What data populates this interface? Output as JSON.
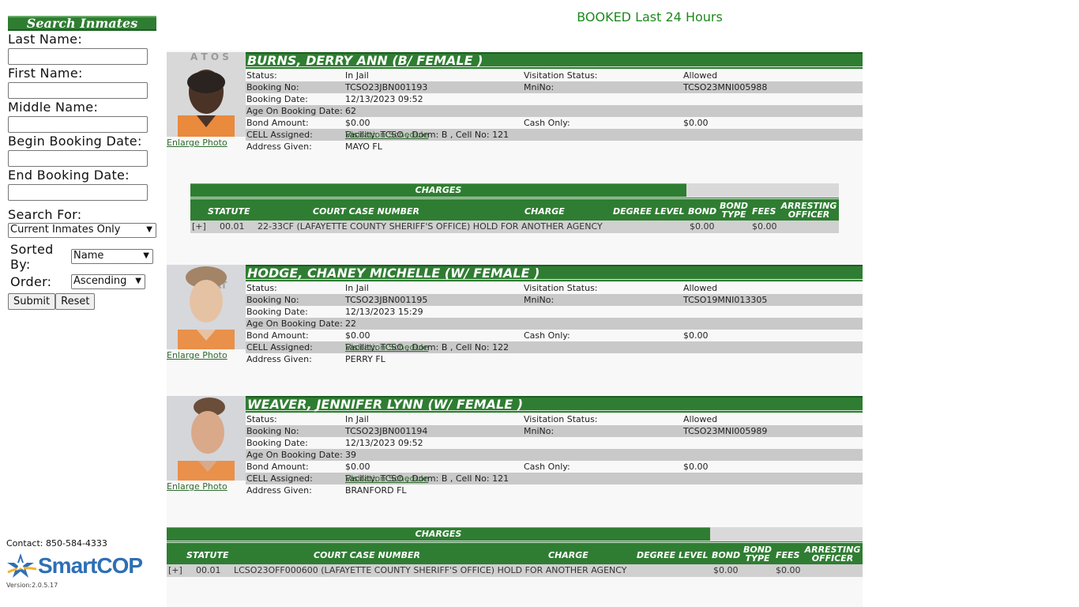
{
  "sidebar": {
    "title": "Search Inmates",
    "last_name_label": "Last Name:",
    "first_name_label": "First Name:",
    "middle_name_label": "Middle Name:",
    "begin_date_label": "Begin Booking Date:",
    "end_date_label": "End Booking Date:",
    "search_for_label": "Search For:",
    "search_for_value": "Current Inmates Only",
    "sorted_by_label": "Sorted By:",
    "sorted_by_value": "Name",
    "order_label": "Order:",
    "order_value": "Ascending",
    "submit_label": "Submit",
    "reset_label": "Reset"
  },
  "footer": {
    "contact": "Contact: 850-584-4333",
    "logo_smart": "Smart",
    "logo_cop": "COP",
    "version": "Version:2.0.5.17"
  },
  "page_title": "BOOKED Last 24 Hours",
  "labels": {
    "status": "Status:",
    "visitation_status": "Visitation Status:",
    "booking_no": "Booking No:",
    "mnino": "MniNo:",
    "booking_date": "Booking Date:",
    "age": "Age On Booking Date:",
    "bond_amount": "Bond Amount:",
    "cash_only": "Cash Only:",
    "cell": "CELL Assigned:",
    "address": "Address Given:",
    "enlarge_photo": "Enlarge Photo",
    "visitation_schedule": "Visitation Schedule"
  },
  "charges_header": {
    "title": "CHARGES",
    "statute": "STATUTE",
    "court_case": "COURT CASE NUMBER",
    "charge": "CHARGE",
    "degree_level": "DEGREE LEVEL",
    "bond": "BOND",
    "bond_type": "BOND TYPE",
    "fees": "FEES",
    "arresting_officer": "ARRESTING OFFICER"
  },
  "inmates": [
    {
      "name": "BURNS, DERRY ANN   (B/ FEMALE )",
      "status": "In Jail",
      "visitation_status": "Allowed",
      "booking_no": "TCSO23JBN001193",
      "mnino": "TCSO23MNI005988",
      "booking_date": "12/13/2023 09:52",
      "age": "62",
      "bond_amount": "$0.00",
      "cash_only": "$0.00",
      "cell": "Facility: TCSO , Dorm: B , Cell No: 121",
      "address": "MAYO FL",
      "charge": {
        "expand": "[+]",
        "statute": "00.01",
        "text": "22-33CF (LAFAYETTE COUNTY SHERIFF'S OFFICE) HOLD FOR ANOTHER AGENCY",
        "bond": "$0.00",
        "fees": "$0.00"
      }
    },
    {
      "name": "HODGE, CHANEY MICHELLE   (W/ FEMALE )",
      "status": "In Jail",
      "visitation_status": "Allowed",
      "booking_no": "TCSO23JBN001195",
      "mnino": "TCSO19MNI013305",
      "booking_date": "12/13/2023 15:29",
      "age": "22",
      "bond_amount": "$0.00",
      "cash_only": "$0.00",
      "cell": "Facility: TCSO , Dorm: B , Cell No: 122",
      "address": "PERRY FL"
    },
    {
      "name": "WEAVER, JENNIFER LYNN   (W/ FEMALE )",
      "status": "In Jail",
      "visitation_status": "Allowed",
      "booking_no": "TCSO23JBN001194",
      "mnino": "TCSO23MNI005989",
      "booking_date": "12/13/2023 09:52",
      "age": "39",
      "bond_amount": "$0.00",
      "cash_only": "$0.00",
      "cell": "Facility: TCSO , Dorm: B , Cell No: 121",
      "address": "BRANFORD FL",
      "charge": {
        "expand": "[+]",
        "statute": "00.01",
        "text": "LCSO23OFF000600 (LAFAYETTE COUNTY SHERIFF'S OFFICE) HOLD FOR ANOTHER AGENCY",
        "bond": "$0.00",
        "fees": "$0.00"
      }
    }
  ],
  "colors": {
    "header_green": "#2f7d32",
    "title_green": "#1e8a1e",
    "link_green": "#2f6b2f",
    "shade_gray": "#c9c9c9",
    "logo_blue": "#2e6fb5"
  }
}
